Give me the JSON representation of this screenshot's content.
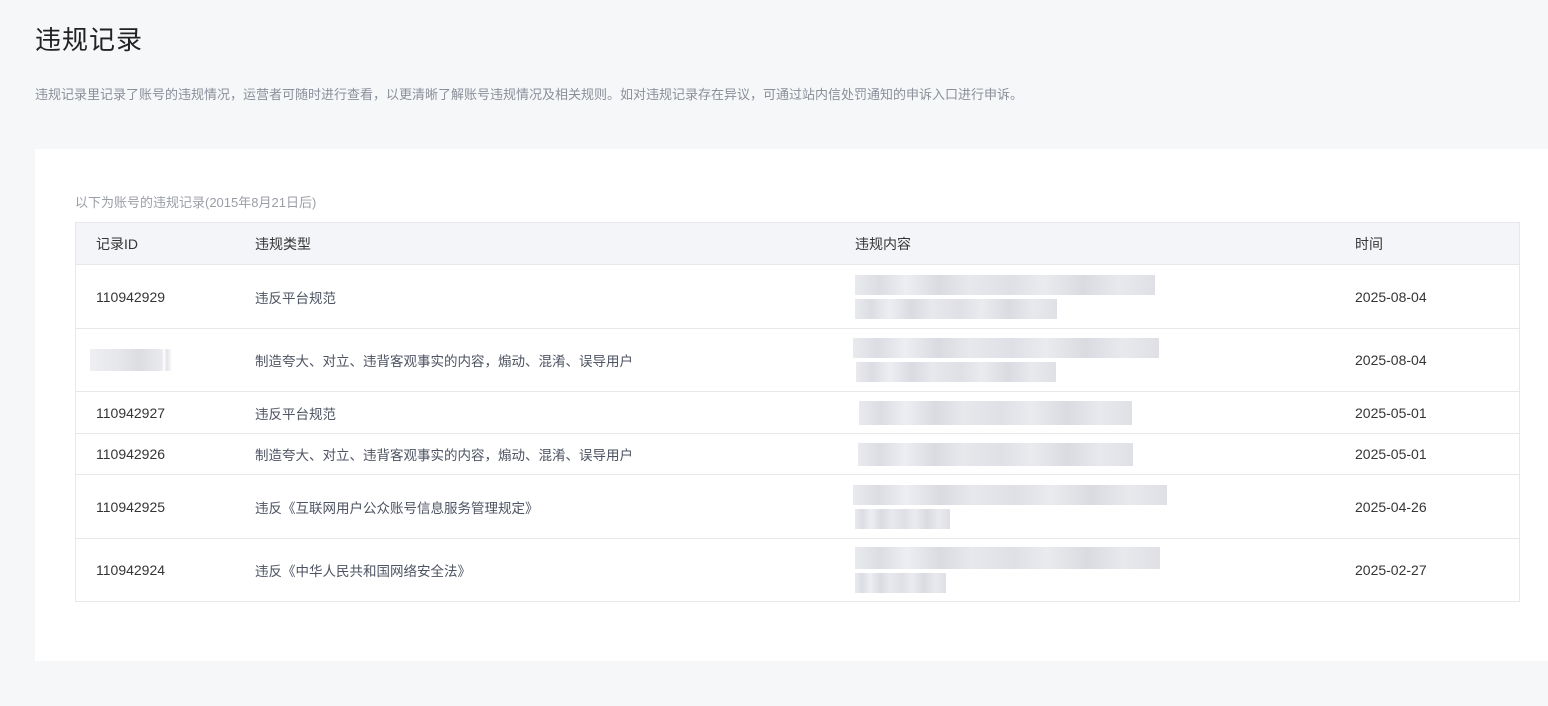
{
  "page": {
    "title": "违规记录",
    "description": "违规记录里记录了账号的违规情况，运营者可随时进行查看，以更清晰了解账号违规情况及相关规则。如对违规记录存在异议，可通过站内信处罚通知的申诉入口进行申诉。"
  },
  "records": {
    "caption": "以下为账号的违规记录(2015年8月21日后)",
    "headers": {
      "id": "记录ID",
      "type": "违规类型",
      "content": "违规内容",
      "time": "时间"
    },
    "rows": [
      {
        "id": "110942929",
        "type": "违反平台规范",
        "time": "2025-08-04"
      },
      {
        "id": "",
        "type": "制造夸大、对立、违背客观事实的内容，煽动、混淆、误导用户",
        "time": "2025-08-04"
      },
      {
        "id": "110942927",
        "type": "违反平台规范",
        "time": "2025-05-01"
      },
      {
        "id": "110942926",
        "type": "制造夸大、对立、违背客观事实的内容，煽动、混淆、误导用户",
        "time": "2025-05-01"
      },
      {
        "id": "110942925",
        "type": "违反《互联网用户公众账号信息服务管理规定》",
        "time": "2025-04-26"
      },
      {
        "id": "110942924",
        "type": "违反《中华人民共和国网络安全法》",
        "time": "2025-02-27"
      }
    ]
  }
}
